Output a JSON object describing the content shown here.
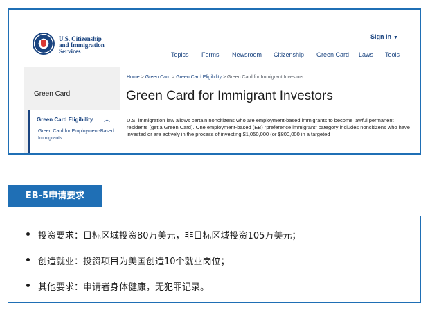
{
  "site": {
    "agency_lines": [
      "U.S. Citizenship",
      "and Immigration",
      "Services"
    ],
    "signin": "Sign In",
    "nav": [
      "Topics",
      "Forms",
      "Newsroom",
      "Citizenship",
      "Green Card",
      "Laws",
      "Tools"
    ]
  },
  "sidebar": {
    "title": "Green Card",
    "section": "Green Card Eligibility",
    "sub_item": "Green Card for Employment-Based Immigrants"
  },
  "breadcrumb": {
    "items": [
      "Home",
      "Green Card",
      "Green Card Eligibility",
      "Green Card for Immigrant Investors"
    ],
    "separator": ">"
  },
  "page": {
    "title": "Green Card for Immigrant Investors",
    "intro": "U.S. immigration law allows certain noncitizens who are employment-based immigrants to become lawful permanent residents (get a Green Card). One employment-based (EB) “preference immigrant” category includes noncitizens who have invested or are actively in the process of investing $1,050,000 (or $800,000 in a targeted"
  },
  "article": {
    "heading": "EB-5申请要求",
    "requirements": [
      "投资要求：目标区域投资80万美元，非目标区域投资105万美元；",
      "创造就业：投资项目为美国创造10个就业岗位；",
      "其他要求：申请者身体健康，无犯罪记录。"
    ]
  },
  "colors": {
    "accent": "#1f6fb5",
    "uscis_navy": "#1a4480"
  }
}
